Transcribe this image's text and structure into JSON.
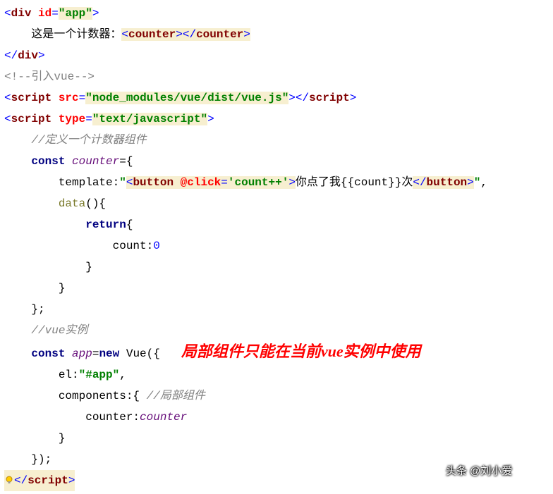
{
  "lines": {
    "l1": {
      "open": "<",
      "div": "div",
      "sp": " ",
      "id": "id",
      "eq": "=",
      "val": "\"app\"",
      "close": ">"
    },
    "l2": {
      "indent": "    ",
      "text": "这是一个计数器：",
      "open": "<",
      "tag": "counter",
      "close1": ">",
      "open2": "</",
      "close2": ">"
    },
    "l3": {
      "open": "</",
      "tag": "div",
      "close": ">"
    },
    "l4": {
      "text": "<!--引入vue-->"
    },
    "l5": {
      "open": "<",
      "tag": "script",
      "sp": " ",
      "attr": "src",
      "eq": "=",
      "val": "\"node_modules/vue/dist/vue.js\"",
      "close1": ">",
      "open2": "</",
      "close2": ">"
    },
    "l6": {
      "open": "<",
      "tag": "script",
      "sp": " ",
      "attr": "type",
      "eq": "=",
      "val": "\"text/javascript\"",
      "close": ">"
    },
    "l7": {
      "indent": "    ",
      "text": "//定义一个计数器组件"
    },
    "l8": {
      "indent": "    ",
      "const": "const ",
      "name": "counter",
      "rest": "={"
    },
    "l9": {
      "indent": "        ",
      "key": "template:",
      "q": "\"",
      "open": "<",
      "btn": "button",
      "sp": " ",
      "attr": "@click",
      "eq": "=",
      "val": "'count++'",
      "close1": ">",
      "inner": "你点了我{{count}}次",
      "open2": "</",
      "close2": ">",
      "q2": "\"",
      "comma": ","
    },
    "l10": {
      "indent": "        ",
      "fn": "data",
      "rest": "(){"
    },
    "l11": {
      "indent": "            ",
      "kw": "return",
      "rest": "{"
    },
    "l12": {
      "indent": "                ",
      "key": "count:",
      "num": "0"
    },
    "l13": {
      "indent": "            ",
      "text": "}"
    },
    "l14": {
      "indent": "        ",
      "text": "}"
    },
    "l15": {
      "indent": "    ",
      "text": "};"
    },
    "l16": {
      "indent": "    ",
      "text": "//vue实例"
    },
    "l17": {
      "indent": "    ",
      "const": "const ",
      "name": "app",
      "eq": "=",
      "new": "new ",
      "cls": "Vue({"
    },
    "l18": {
      "indent": "        ",
      "key": "el:",
      "val": "\"#app\"",
      "comma": ","
    },
    "l19": {
      "indent": "        ",
      "key": "components:{ ",
      "cmt": "//局部组件"
    },
    "l20": {
      "indent": "            ",
      "key": "counter:",
      "val": "counter"
    },
    "l21": {
      "indent": "        ",
      "text": "}"
    },
    "l22": {
      "indent": "    ",
      "text": "});"
    },
    "l23": {
      "open": "</",
      "tag": "script",
      "close": ">"
    }
  },
  "annotation": "局部组件只能在当前vue实例中使用",
  "watermark": "头条 @刘小爱"
}
